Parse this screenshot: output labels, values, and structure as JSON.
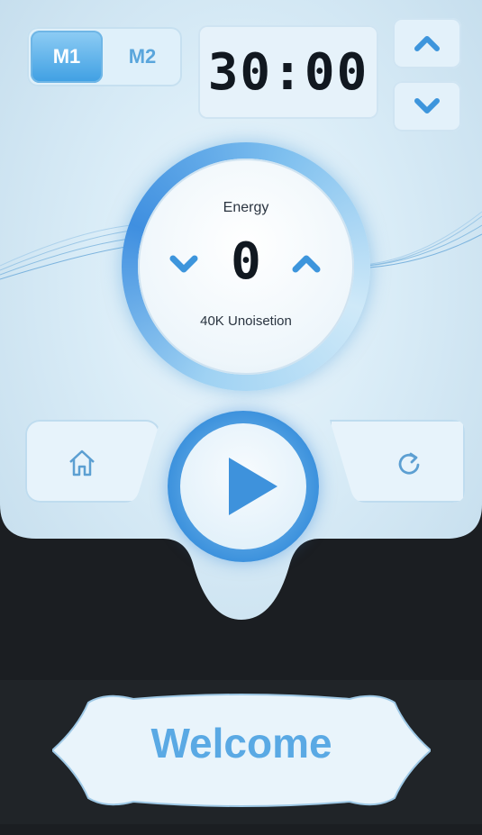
{
  "modes": {
    "m1_label": "M1",
    "m2_label": "M2",
    "selected": "M1"
  },
  "timer": {
    "display": "30:00",
    "up_icon": "chevron-up-icon",
    "down_icon": "chevron-down-icon"
  },
  "energy": {
    "label": "Energy",
    "value": "0",
    "subtitle": "40K Unoisetion"
  },
  "actions": {
    "home_icon": "home-icon",
    "play_icon": "play-icon",
    "refresh_icon": "refresh-icon"
  },
  "welcome": {
    "text": "Welcome"
  },
  "colors": {
    "accent": "#3e9fe3",
    "panel": "#d9ecf7",
    "background": "#1b1e22",
    "text_dark": "#111820"
  }
}
